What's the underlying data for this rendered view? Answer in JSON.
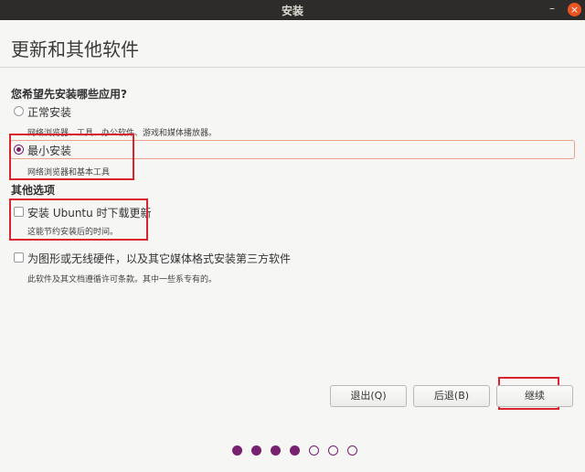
{
  "window": {
    "title": "安装",
    "minimize_glyph": "–",
    "close_glyph": "×"
  },
  "page": {
    "title": "更新和其他软件"
  },
  "apps_section": {
    "heading": "您希望先安装哪些应用?",
    "options": [
      {
        "label": "正常安装",
        "description": "网络浏览器、工具、办公软件、游戏和媒体播放器。",
        "selected": false
      },
      {
        "label": "最小安装",
        "description": "网络浏览器和基本工具",
        "selected": true
      }
    ]
  },
  "other_section": {
    "heading": "其他选项",
    "options": [
      {
        "label": "安装 Ubuntu 时下载更新",
        "description": "这能节约安装后的时间。",
        "checked": false
      },
      {
        "label": "为图形或无线硬件，以及其它媒体格式安装第三方软件",
        "description": "此软件及其文档遵循许可条款。其中一些系专有的。",
        "checked": false
      }
    ]
  },
  "buttons": {
    "quit": "退出(Q)",
    "back": "后退(B)",
    "continue": "继续"
  },
  "progress": {
    "total_steps": 7,
    "completed_steps": 4
  },
  "colors": {
    "accent": "#77216f",
    "close": "#e95420",
    "highlight": "#d9232d"
  }
}
